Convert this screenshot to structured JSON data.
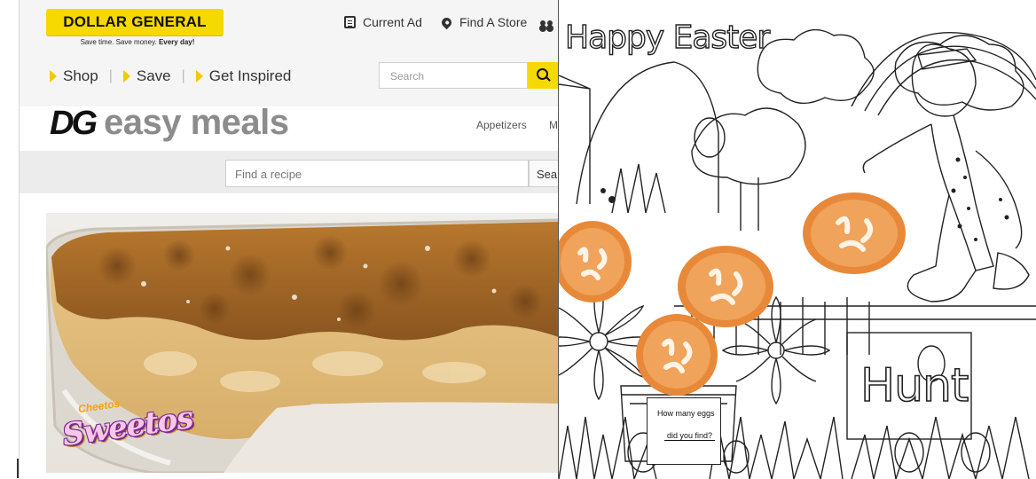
{
  "website": {
    "brand": {
      "logo_text": "DOLLAR GENERAL",
      "tagline_plain": "Save time. Save money.",
      "tagline_bold": "Every day!"
    },
    "top_links": {
      "current_ad": "Current Ad",
      "find_store": "Find A Store"
    },
    "nav": [
      {
        "label": "Shop"
      },
      {
        "label": "Save"
      },
      {
        "label": "Get Inspired"
      }
    ],
    "search": {
      "placeholder": "Search"
    },
    "easy_meals": {
      "mark": "DG",
      "word": "easy meals",
      "categories": [
        "Appetizers",
        "M"
      ]
    },
    "recipe_search": {
      "placeholder": "Find a recipe",
      "button": "Sea"
    },
    "hero_brand": {
      "top": "Cheetos",
      "main": "Sweetos"
    }
  },
  "coloring_page": {
    "title": "Happy Easter",
    "word": "Hunt",
    "card": {
      "line1": "How many eggs",
      "line2": "did you find?"
    }
  },
  "colors": {
    "dg_yellow": "#f5d900",
    "nav_arrow": "#f5c800",
    "easy_meals_gray": "#8c8c8c",
    "pretzel_orange": "#e8893a",
    "sweetos_purple": "#7a2a8e",
    "sweetos_pink": "#f6c7e8"
  }
}
